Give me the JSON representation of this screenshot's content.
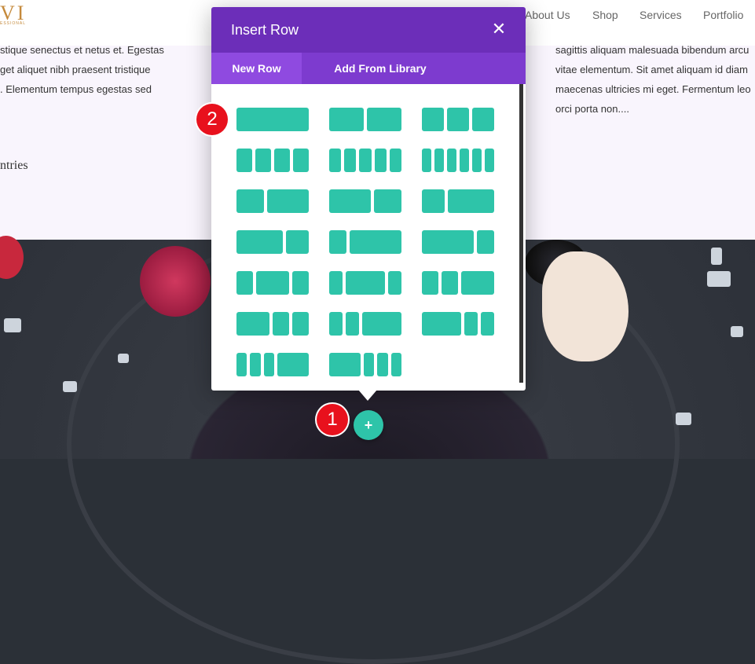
{
  "site": {
    "logo_text": "VI",
    "logo_subtext": "ESSIONAL",
    "nav": [
      "About Us",
      "Shop",
      "Services",
      "Portfolio"
    ]
  },
  "content": {
    "left_lines": [
      "stique senectus et netus et. Egestas",
      "get aliquet nibh praesent tristique",
      ". Elementum tempus egestas sed"
    ],
    "left_heading": "ntries",
    "right_lines": [
      "sagittis aliquam malesuada bibendum arcu",
      "vitae elementum. Sit amet aliquam id diam",
      "maecenas ultricies mi eget. Fermentum leo",
      "orci porta non...."
    ]
  },
  "modal": {
    "title": "Insert Row",
    "close_glyph": "✕",
    "tabs": [
      {
        "label": "New Row",
        "active": true
      },
      {
        "label": "Add From Library",
        "active": false
      }
    ],
    "column_color": "#2ec4a9",
    "header_color": "#6c2eb9",
    "layouts": [
      {
        "name": "1",
        "cols": [
          1
        ]
      },
      {
        "name": "1/2 1/2",
        "cols": [
          1,
          1
        ]
      },
      {
        "name": "1/3 1/3 1/3",
        "cols": [
          1,
          1,
          1
        ]
      },
      {
        "name": "1/4 x4",
        "cols": [
          1,
          1,
          1,
          1
        ]
      },
      {
        "name": "1/5 x5",
        "cols": [
          1,
          1,
          1,
          1,
          1
        ]
      },
      {
        "name": "1/6 x6",
        "cols": [
          1,
          1,
          1,
          1,
          1,
          1
        ]
      },
      {
        "name": "2/5 3/5",
        "cols": [
          2,
          3
        ]
      },
      {
        "name": "3/5 2/5",
        "cols": [
          3,
          2
        ]
      },
      {
        "name": "1/3 2/3",
        "cols": [
          1,
          2
        ]
      },
      {
        "name": "2/3 1/3",
        "cols": [
          2,
          1
        ]
      },
      {
        "name": "1/4 3/4",
        "cols": [
          1,
          3
        ]
      },
      {
        "name": "3/4 1/4",
        "cols": [
          3,
          1
        ]
      },
      {
        "name": "1/4 1/2 1/4",
        "cols": [
          1,
          2,
          1
        ]
      },
      {
        "name": "1/5 3/5 1/5",
        "cols": [
          1,
          3,
          1
        ]
      },
      {
        "name": "1/4 1/4 1/2",
        "cols": [
          1,
          1,
          2
        ]
      },
      {
        "name": "1/2 1/4 1/4",
        "cols": [
          2,
          1,
          1
        ]
      },
      {
        "name": "1/5 1/5 3/5",
        "cols": [
          1,
          1,
          3
        ]
      },
      {
        "name": "3/5 1/5 1/5",
        "cols": [
          3,
          1,
          1
        ]
      },
      {
        "name": "1/6 1/6 1/6 1/2",
        "cols": [
          1,
          1,
          1,
          3
        ]
      },
      {
        "name": "1/2 1/6 1/6 1/6",
        "cols": [
          3,
          1,
          1,
          1
        ]
      }
    ]
  },
  "badges": {
    "step1": "1",
    "step2": "2"
  },
  "add_button": {
    "glyph": "+"
  }
}
